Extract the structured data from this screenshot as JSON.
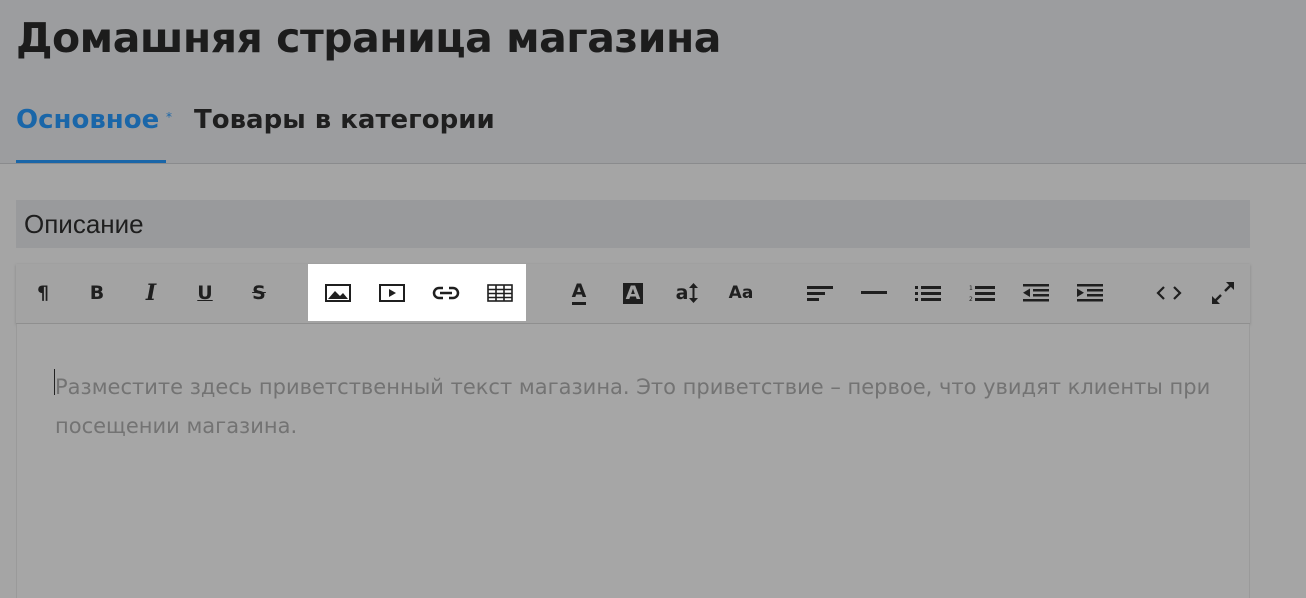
{
  "page": {
    "title": "Домашняя страница магазина"
  },
  "tabs": [
    {
      "label": "Основное",
      "mark": "*",
      "active": true
    },
    {
      "label": "Товары в категории",
      "active": false
    }
  ],
  "section": {
    "label": "Описание"
  },
  "toolbar": {
    "highlighted_group": [
      "image-icon",
      "video-icon",
      "link-icon",
      "table-icon"
    ],
    "buttons": [
      {
        "icon": "paragraph-icon",
        "glyph": "¶"
      },
      {
        "icon": "bold-icon",
        "glyph": "B"
      },
      {
        "icon": "italic-icon",
        "glyph": "I"
      },
      {
        "icon": "underline-icon",
        "glyph": "U"
      },
      {
        "icon": "strikethrough-icon",
        "glyph": "S"
      },
      {
        "icon": "image-icon"
      },
      {
        "icon": "video-icon"
      },
      {
        "icon": "link-icon"
      },
      {
        "icon": "table-icon"
      },
      {
        "icon": "text-color-icon",
        "glyph": "A"
      },
      {
        "icon": "background-color-icon",
        "glyph": "A"
      },
      {
        "icon": "font-size-icon",
        "glyph": "a"
      },
      {
        "icon": "font-family-icon",
        "glyph": "Aa"
      },
      {
        "icon": "align-icon"
      },
      {
        "icon": "horizontal-line-icon"
      },
      {
        "icon": "bulleted-list-icon"
      },
      {
        "icon": "numbered-list-icon"
      },
      {
        "icon": "outdent-icon"
      },
      {
        "icon": "indent-icon"
      },
      {
        "icon": "code-view-icon",
        "glyph": "<>"
      },
      {
        "icon": "fullscreen-icon"
      }
    ]
  },
  "editor": {
    "placeholder": "Разместите здесь приветственный текст магазина. Это приветствие – первое, что увидят клиенты при посещении магазина."
  },
  "colors": {
    "accent": "#1a66a8",
    "overlay": "#a5a5a5",
    "highlight": "#ffffff"
  }
}
